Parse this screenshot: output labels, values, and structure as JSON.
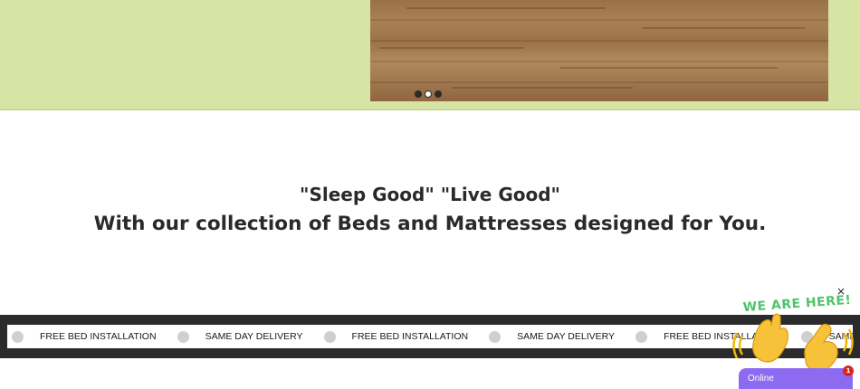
{
  "hero": {
    "carousel_dots": [
      {
        "active": false
      },
      {
        "active": true
      },
      {
        "active": false
      }
    ],
    "background_color": "#d6e5a3"
  },
  "tagline": {
    "line1": "\"Sleep Good\" \"Live Good\"",
    "line2": "With our collection of Beds and Mattresses designed for You."
  },
  "marquee": {
    "items": [
      "FREE BED INSTALLATION",
      "SAME DAY DELIVERY",
      "FREE BED INSTALLATION",
      "SAME DAY DELIVERY",
      "FREE BED INSTALLATION",
      "SAME DAY DELIVERY"
    ]
  },
  "chat": {
    "heading": "WE ARE HERE!",
    "close_label": "×",
    "status": "Online",
    "unread_count": "1",
    "accent_color": "#8d6bf0"
  }
}
